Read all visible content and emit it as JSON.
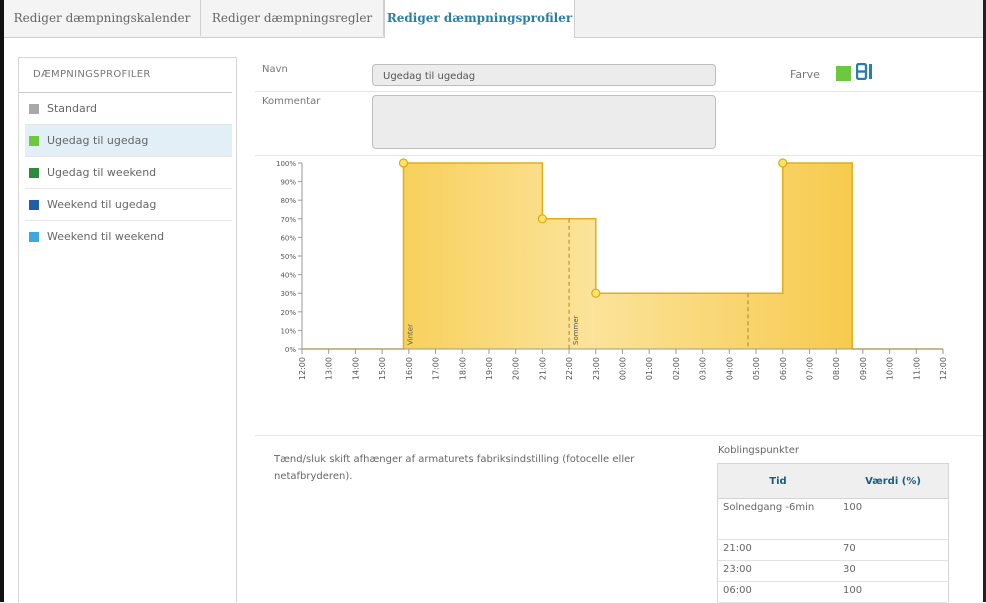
{
  "tabs": [
    {
      "label": "Rediger dæmpningskalender",
      "active": false
    },
    {
      "label": "Rediger dæmpningsregler",
      "active": false
    },
    {
      "label": "Rediger dæmpningsprofiler",
      "active": true
    }
  ],
  "sidebar": {
    "title": "DÆMPNINGSPROFILER",
    "items": [
      {
        "label": "Standard",
        "color": "#a8a8a8"
      },
      {
        "label": "Ugedag til ugedag",
        "color": "#6cc93f",
        "selected": true
      },
      {
        "label": "Ugedag til weekend",
        "color": "#2e8b3c"
      },
      {
        "label": "Weekend til ugedag",
        "color": "#1e5fa8"
      },
      {
        "label": "Weekend til weekend",
        "color": "#3fa8df"
      }
    ]
  },
  "form": {
    "name_label": "Navn",
    "name_value": "Ugedag til ugedag",
    "color_label": "Farve",
    "color_value": "#6cc93f",
    "color_icon": "palette-icon",
    "comment_label": "Kommentar",
    "comment_value": ""
  },
  "chart_data": {
    "type": "area",
    "title": "",
    "xlabel": "",
    "ylabel": "",
    "yticks": [
      "100%",
      "90%",
      "80%",
      "70%",
      "60%",
      "50%",
      "40%",
      "30%",
      "20%",
      "10%",
      "0%"
    ],
    "ylim": [
      0,
      100
    ],
    "xticks": [
      "12:00",
      "13:00",
      "14:00",
      "15:00",
      "16:00",
      "17:00",
      "18:00",
      "19:00",
      "20:00",
      "21:00",
      "22:00",
      "23:00",
      "00:00",
      "01:00",
      "02:00",
      "03:00",
      "04:00",
      "05:00",
      "06:00",
      "07:00",
      "08:00",
      "09:00",
      "10:00",
      "11:00",
      "12:00"
    ],
    "x_hours": [
      12,
      15.8,
      15.8,
      21,
      21,
      23,
      23,
      30,
      30,
      32.6,
      32.6,
      36
    ],
    "values": [
      0,
      0,
      100,
      100,
      70,
      70,
      30,
      30,
      100,
      100,
      0,
      0
    ],
    "markers": [
      {
        "x": 15.8,
        "y": 100
      },
      {
        "x": 21,
        "y": 70
      },
      {
        "x": 23,
        "y": 30
      },
      {
        "x": 30,
        "y": 100
      }
    ],
    "annotations": [
      {
        "label": "Vinter",
        "x": 15.8
      },
      {
        "label": "Sommer",
        "x": 22
      }
    ],
    "dashed_lines": [
      22,
      28.7
    ],
    "fill_color": "#f5c842",
    "grid": false
  },
  "info_text": "Tænd/sluk skift afhænger  af armaturets fabriksindstilling (fotocelle eller netafbryderen).",
  "koblingspunkter": {
    "title": "Koblingspunkter",
    "headers": [
      "Tid",
      "Værdi (%)"
    ],
    "rows": [
      [
        "Solnedgang -6min",
        "100"
      ],
      [
        "21:00",
        "70"
      ],
      [
        "23:00",
        "30"
      ],
      [
        "06:00",
        "100"
      ]
    ]
  }
}
